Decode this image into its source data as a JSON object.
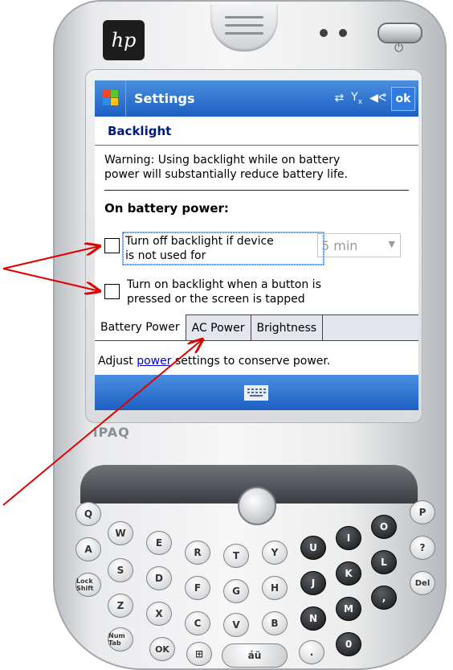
{
  "device": {
    "brand_logo": "hp",
    "model_label": "iPAQ",
    "power_glyph": "⏻"
  },
  "titlebar": {
    "start_icon": "windows-flag-icon",
    "app_title": "Settings",
    "status_icons": [
      "connectivity-icon",
      "signal-off-icon",
      "speaker-icon"
    ],
    "ok_label": "ok",
    "colors": {
      "bar": "#2a6fd0",
      "accent_text": "#001a80",
      "link": "#0000d6"
    }
  },
  "page": {
    "title": "Backlight",
    "warning_line1": "Warning: Using backlight while on battery",
    "warning_line2": "power will substantially reduce battery life.",
    "section_heading": "On battery power:",
    "option1_line1": "Turn off backlight if device",
    "option1_line2": "is not used for",
    "option1_checked": false,
    "timeout_value": "5 min",
    "option2_line1": "Turn on backlight when a button is",
    "option2_line2": "pressed or the screen is tapped",
    "option2_checked": false
  },
  "tabs": {
    "items": [
      "Battery Power",
      "AC Power",
      "Brightness"
    ],
    "active": "Battery Power"
  },
  "footer": {
    "prefix": "Adjust ",
    "link": "power",
    "suffix": " settings to conserve power."
  },
  "menubar": {
    "center_icon": "keyboard-icon"
  },
  "keys": {
    "row1": [
      "Q",
      "W",
      "E",
      "R",
      "T",
      "Y",
      "U",
      "I",
      "O",
      "P"
    ],
    "row2": [
      "A",
      "S",
      "D",
      "F",
      "G",
      "H",
      "J",
      "K",
      "L",
      "?"
    ],
    "row3": [
      "Lock Shift",
      "Z",
      "X",
      "C",
      "V",
      "B",
      "N",
      "M",
      ",",
      "Del"
    ],
    "row4": [
      "Num Tab",
      "OK",
      "áü",
      "."
    ]
  }
}
